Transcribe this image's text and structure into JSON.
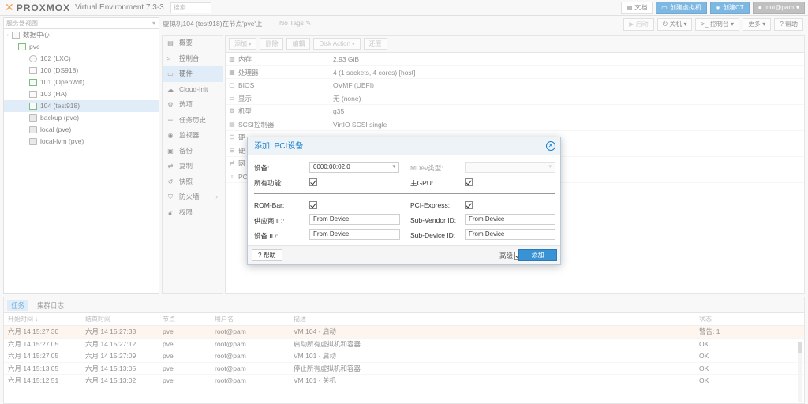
{
  "top": {
    "logo": "PROXMOX",
    "version": "Virtual Environment 7.3-3",
    "search_placeholder": "搜索",
    "docs": "文档",
    "create_vm": "创建虚拟机",
    "create_ct": "创建CT",
    "user": "root@pam"
  },
  "tree": {
    "view": "服务器视图",
    "items": [
      {
        "label": "数据中心"
      },
      {
        "label": "pve"
      },
      {
        "label": "102 (LXC)"
      },
      {
        "label": "100 (DS918)"
      },
      {
        "label": "101 (OpenWrt)"
      },
      {
        "label": "103 (HA)"
      },
      {
        "label": "104 (test918)"
      },
      {
        "label": "backup (pve)"
      },
      {
        "label": "local (pve)"
      },
      {
        "label": "local-lvm (pve)"
      }
    ]
  },
  "vm": {
    "title": "虚拟机104 (test918)在节点'pve'上",
    "notags": "No Tags",
    "actions": [
      "启动",
      "关机",
      "控制台",
      "更多",
      "帮助"
    ]
  },
  "menu": [
    "概要",
    "控制台",
    "硬件",
    "Cloud-Init",
    "选项",
    "任务历史",
    "监视器",
    "备份",
    "复制",
    "快照",
    "防火墙",
    "权限"
  ],
  "hw": {
    "toolbar": [
      "添加",
      "删除",
      "编辑",
      "Disk Action",
      "还原"
    ],
    "rows": [
      {
        "k": "内存",
        "v": "2.93 GiB"
      },
      {
        "k": "处理器",
        "v": "4 (1 sockets, 4 cores) [host]"
      },
      {
        "k": "BIOS",
        "v": "OVMF (UEFI)"
      },
      {
        "k": "显示",
        "v": "无 (none)"
      },
      {
        "k": "机型",
        "v": "q35"
      },
      {
        "k": "SCSI控制器",
        "v": "VirtIO SCSI single"
      },
      {
        "k": "硬",
        "v": ""
      },
      {
        "k": "硬",
        "v": ""
      },
      {
        "k": "网",
        "v": ""
      },
      {
        "k": "PC",
        "v": ""
      }
    ]
  },
  "dialog": {
    "title": "添加: PCI设备",
    "device_label": "设备:",
    "device_value": "0000:00:02.0",
    "mdev_label": "MDev类型:",
    "allfunc_label": "所有功能:",
    "primary_gpu_label": "主GPU:",
    "rombar_label": "ROM-Bar:",
    "pcie_label": "PCI-Express:",
    "vendor_label": "供应商 ID:",
    "vendor_value": "From Device",
    "subvendor_label": "Sub-Vendor ID:",
    "subvendor_value": "From Device",
    "devid_label": "设备 ID:",
    "devid_value": "From Device",
    "subdev_label": "Sub-Device ID:",
    "subdev_value": "From Device",
    "help": "帮助",
    "advanced": "高级",
    "add": "添加"
  },
  "log": {
    "tabs": [
      "任务",
      "集群日志"
    ],
    "headers": [
      "开始时间",
      "结束时间",
      "节点",
      "用户名",
      "描述",
      "状态"
    ],
    "rows": [
      {
        "start": "六月 14 15:27:30",
        "end": "六月 14 15:27:33",
        "node": "pve",
        "user": "root@pam",
        "desc": "VM 104 - 启动",
        "status": "警告: 1"
      },
      {
        "start": "六月 14 15:27:05",
        "end": "六月 14 15:27:12",
        "node": "pve",
        "user": "root@pam",
        "desc": "启动所有虚拟机和容器",
        "status": "OK"
      },
      {
        "start": "六月 14 15:27:05",
        "end": "六月 14 15:27:09",
        "node": "pve",
        "user": "root@pam",
        "desc": "VM 101 - 启动",
        "status": "OK"
      },
      {
        "start": "六月 14 15:13:05",
        "end": "六月 14 15:13:05",
        "node": "pve",
        "user": "root@pam",
        "desc": "停止所有虚拟机和容器",
        "status": "OK"
      },
      {
        "start": "六月 14 15:12:51",
        "end": "六月 14 15:13:02",
        "node": "pve",
        "user": "root@pam",
        "desc": "VM 101 - 关机",
        "status": "OK"
      }
    ]
  }
}
